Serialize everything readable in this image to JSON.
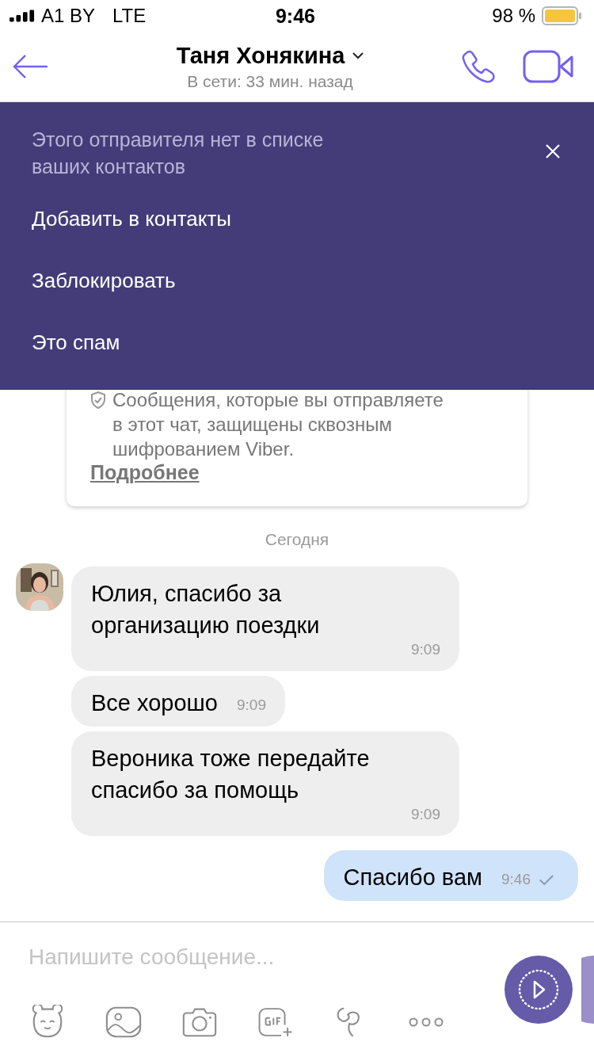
{
  "status_bar": {
    "carrier": "A1 BY",
    "network": "LTE",
    "time": "9:46",
    "battery": "98 %"
  },
  "header": {
    "title": "Таня Хонякина",
    "status": "В сети: 33 мин. назад"
  },
  "banner": {
    "title": "Этого отправителя нет в списке ваших контактов",
    "actions": [
      "Добавить в контакты",
      "Заблокировать",
      "Это спам"
    ]
  },
  "encryption_notice": {
    "text": "Сообщения, которые вы отправляете в этот чат, защищены сквозным шифрованием Viber.",
    "link": "Подробнее"
  },
  "date_separator": "Сегодня",
  "messages": [
    {
      "kind": "incoming",
      "text": "Юлия, спасибо за организацию поездки",
      "time": "9:09",
      "avatar": true
    },
    {
      "kind": "incoming",
      "text": "Все хорошо",
      "time": "9:09",
      "avatar": false
    },
    {
      "kind": "incoming",
      "text": "Вероника тоже передайте спасибо за помощь",
      "time": "9:09",
      "avatar": false
    },
    {
      "kind": "outgoing",
      "text": "Спасибо вам",
      "time": "9:46",
      "avatar": false
    }
  ],
  "composer": {
    "placeholder": "Напишите сообщение..."
  }
}
